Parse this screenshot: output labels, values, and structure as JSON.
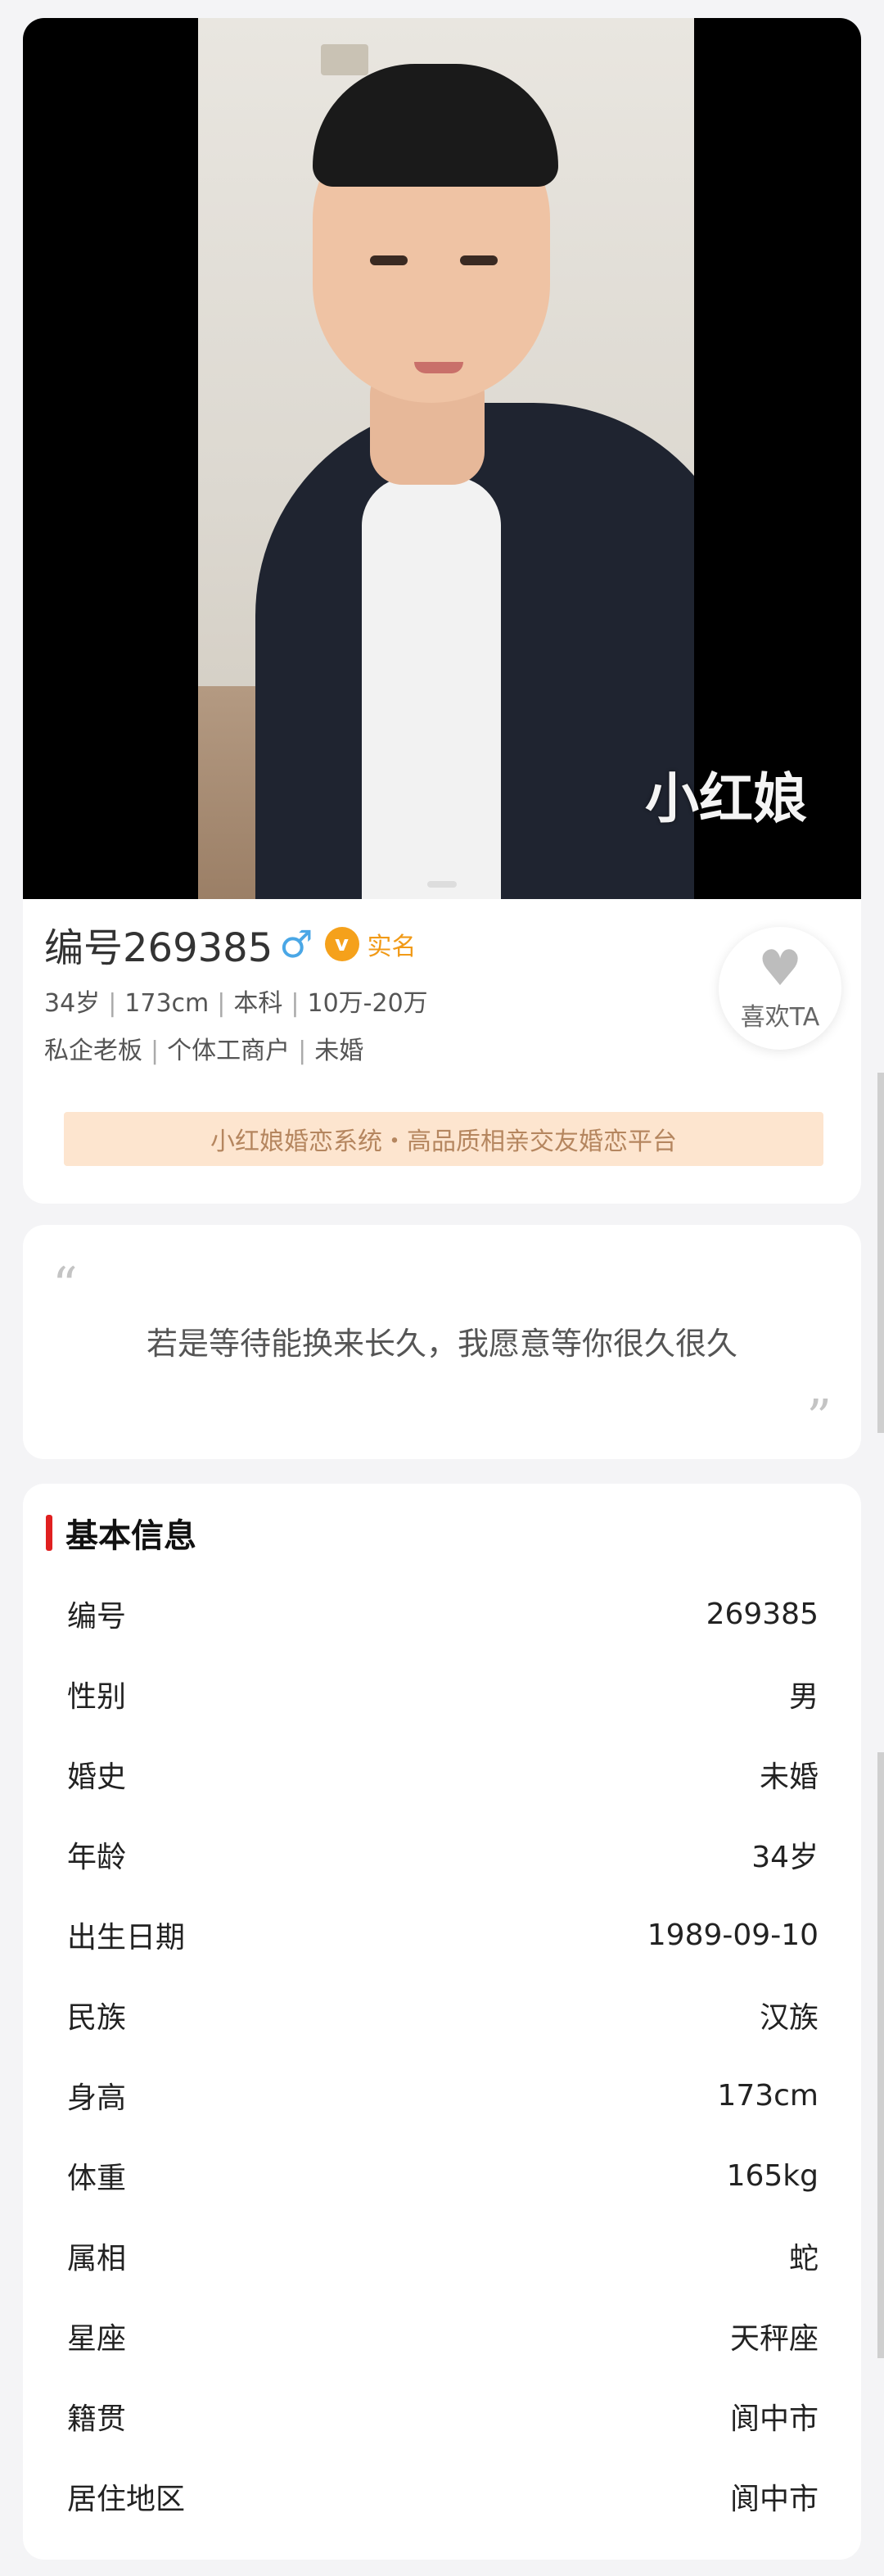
{
  "profile": {
    "photo_watermark": "小红娘",
    "id_label": "编号269385",
    "gender_symbol": "♂",
    "verify_badge_letter": "v",
    "verify_text": "实名",
    "age": "34岁",
    "height": "173cm",
    "education": "本科",
    "income": "10万-20万",
    "occupation": "私企老板",
    "work_type": "个体工商户",
    "marital": "未婚",
    "like_label": "喜欢TA",
    "banner": "小红娘婚恋系统・高品质相亲交友婚恋平台"
  },
  "quote": {
    "open_mark": "“",
    "text": "若是等待能换来长久，我愿意等你很久很久",
    "close_mark": "”"
  },
  "basic_info": {
    "title": "基本信息",
    "rows": [
      {
        "label": "编号",
        "value": "269385"
      },
      {
        "label": "性别",
        "value": "男"
      },
      {
        "label": "婚史",
        "value": "未婚"
      },
      {
        "label": "年龄",
        "value": "34岁"
      },
      {
        "label": "出生日期",
        "value": "1989-09-10"
      },
      {
        "label": "民族",
        "value": "汉族"
      },
      {
        "label": "身高",
        "value": "173cm"
      },
      {
        "label": "体重",
        "value": "165kg"
      },
      {
        "label": "属相",
        "value": "蛇"
      },
      {
        "label": "星座",
        "value": "天秤座"
      },
      {
        "label": "籍贯",
        "value": "阆中市"
      },
      {
        "label": "居住地区",
        "value": "阆中市"
      }
    ]
  },
  "colors": {
    "accent_red": "#e02020",
    "verify_orange": "#f5a11b",
    "gender_blue": "#4aa7e6",
    "banner_bg": "#fde5cf"
  }
}
